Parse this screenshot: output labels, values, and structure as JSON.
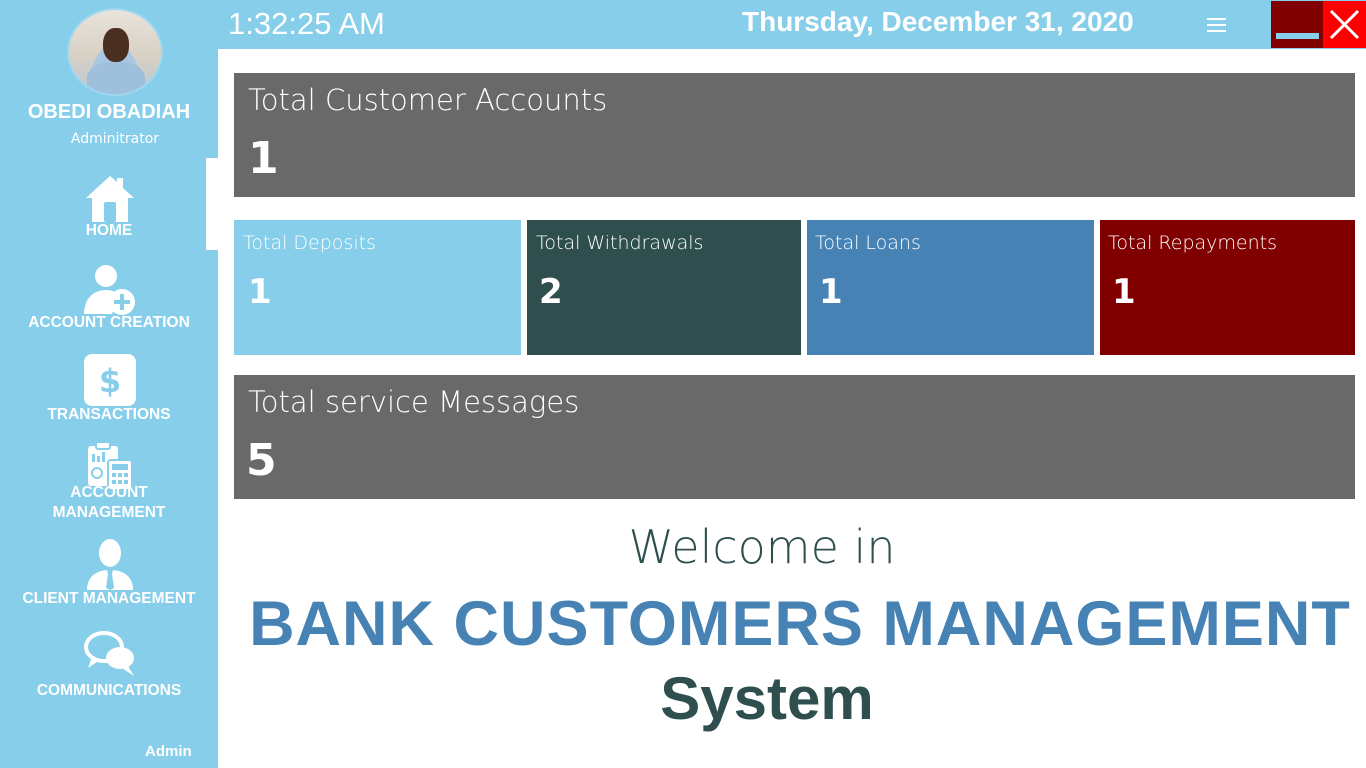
{
  "user": {
    "name": "OBEDI OBADIAH",
    "role": "Adminitrator"
  },
  "nav": {
    "home": "HOME",
    "account_creation": "ACCOUNT CREATION",
    "transactions": "TRANSACTIONS",
    "account_management_line1": "ACCOUNT",
    "account_management_line2": "MANAGEMENT",
    "client_management": "CLIENT MANAGEMENT",
    "communications": "COMMUNICATIONS",
    "active": "home"
  },
  "footer": {
    "user_label": "Admin"
  },
  "topbar": {
    "time": "1:32:25 AM",
    "date": "Thursday, December 31, 2020",
    "icons": [
      "menu-icon",
      "minimize-icon",
      "close-icon"
    ]
  },
  "stats": {
    "customer_accounts": {
      "label": "Total Customer Accounts",
      "value": "1"
    },
    "deposits": {
      "label": "Total Deposits",
      "value": "1"
    },
    "withdrawals": {
      "label": "Total Withdrawals",
      "value": "2"
    },
    "loans": {
      "label": "Total Loans",
      "value": "1"
    },
    "repayments": {
      "label": "Total Repayments",
      "value": "1"
    },
    "service_messages": {
      "label": "Total service Messages",
      "value": "5"
    }
  },
  "welcome": {
    "line1": "Welcome in",
    "title": "BANK CUSTOMERS MANAGEMENT",
    "subtitle": "System"
  },
  "colors": {
    "sidebar": "#87ceeb",
    "card_gray": "#696969",
    "deposits": "#87ceeb",
    "withdrawals": "#2f4f4f",
    "loans": "#4682b4",
    "repayments": "#800000",
    "close": "#ff0000"
  }
}
